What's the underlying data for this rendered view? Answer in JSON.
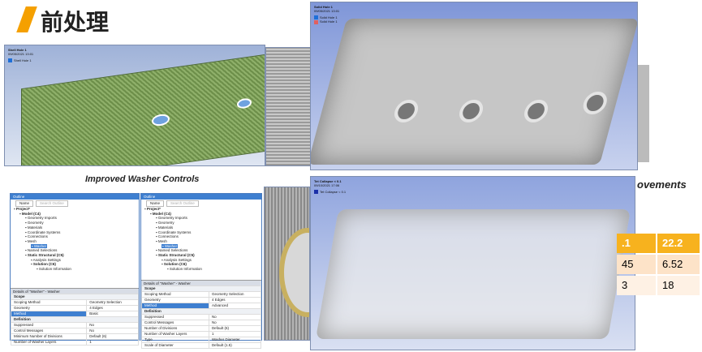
{
  "slide": {
    "title": "前处理",
    "accent": "#f5a000"
  },
  "top_left": {
    "label": "Shell Hole 1",
    "date": "09/05/2021 13:01",
    "legend": "Shell Hole 1"
  },
  "top_right": {
    "label": "Solid Hole 1",
    "date": "09/05/2021 13:01",
    "legend": [
      "Solid Hole 1",
      "Solid Hole 1"
    ]
  },
  "bottom_right": {
    "label": "Tet Collapse < 0.1",
    "date": "09/10/2021 17:06",
    "legend": "Tet Collapse < 0.1"
  },
  "caption_left": "Improved Washer Controls",
  "caption_right": "ovements",
  "table": [
    [
      ".1",
      "22.2"
    ],
    [
      "45",
      "6.52"
    ],
    [
      "3",
      "18"
    ]
  ],
  "outline_a": {
    "header": "Outline",
    "name_filter": "Name",
    "search_placeholder": "Search Outline",
    "tree": [
      "Project*",
      "Model (C4)",
      "Geometry Imports",
      "Geometry",
      "Materials",
      "Coordinate Systems",
      "Connections",
      "Mesh",
      "Washer",
      "Named Selections",
      "Static Structural (C5)",
      "Analysis Settings",
      "Solution (C6)",
      "Solution Information"
    ],
    "details_header": "Details of \"Washer\" - Washer",
    "rows": [
      [
        "Scope",
        ""
      ],
      [
        "Scoping Method",
        "Geometry Selection"
      ],
      [
        "Geometry",
        "4 Edges"
      ],
      [
        "Method",
        "Basic"
      ],
      [
        "Definition",
        ""
      ],
      [
        "Suppressed",
        "No"
      ],
      [
        "Control Messages",
        "No"
      ],
      [
        "Minimum Number of Divisions",
        "Default (6)"
      ],
      [
        "Number of Washer Layers",
        "1"
      ]
    ]
  },
  "outline_b": {
    "header": "Outline",
    "name_filter": "Name",
    "search_placeholder": "Search Outline",
    "tree": [
      "Project*",
      "Model (C4)",
      "Geometry Imports",
      "Geometry",
      "Materials",
      "Coordinate Systems",
      "Connections",
      "Mesh",
      "Washer",
      "Named Selections",
      "Static Structural (C5)",
      "Analysis Settings",
      "Solution (C6)",
      "Solution Information"
    ],
    "details_header": "Details of \"Washer\" - Washer",
    "rows": [
      [
        "Scope",
        ""
      ],
      [
        "Scoping Method",
        "Geometry Selection"
      ],
      [
        "Geometry",
        "4 Edges"
      ],
      [
        "Method",
        "Advanced"
      ],
      [
        "Definition",
        ""
      ],
      [
        "Suppressed",
        "No"
      ],
      [
        "Control Messages",
        "No"
      ],
      [
        "Number of Divisions",
        "Default (6)"
      ],
      [
        "Number of Washer Layers",
        "1"
      ],
      [
        "Type",
        "Washer Diameter"
      ],
      [
        "Scale of Diameter",
        "Default (1.5)"
      ]
    ]
  }
}
